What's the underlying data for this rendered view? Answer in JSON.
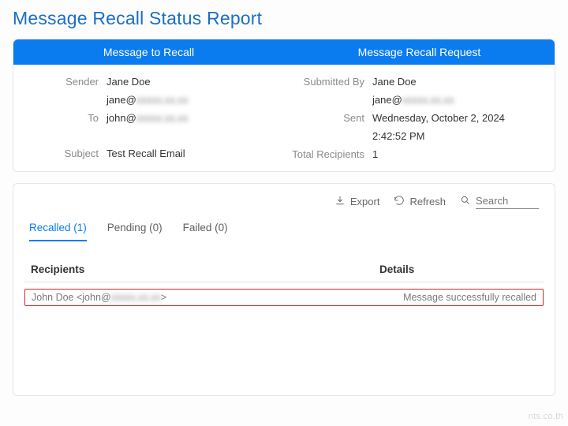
{
  "title": "Message Recall Status Report",
  "header": {
    "left": "Message to Recall",
    "right": "Message Recall Request"
  },
  "recall": {
    "sender_label": "Sender",
    "sender_name": "Jane Doe",
    "sender_email_prefix": "jane@",
    "sender_email_blur": "xxxxx.xx.xx",
    "to_label": "To",
    "to_prefix": "john@",
    "to_blur": "xxxxx.xx.xx",
    "subject_label": "Subject",
    "subject": "Test Recall Email"
  },
  "request": {
    "submitted_label": "Submitted By",
    "submitted_name": "Jane Doe",
    "submitted_email_prefix": "jane@",
    "submitted_email_blur": "xxxxx.xx.xx",
    "sent_label": "Sent",
    "sent_date": "Wednesday, October 2, 2024",
    "sent_time": "2:42:52 PM",
    "total_label": "Total Recipients",
    "total": "1"
  },
  "toolbar": {
    "export": "Export",
    "refresh": "Refresh",
    "search": "Search"
  },
  "tabs": {
    "recalled": "Recalled (1)",
    "pending": "Pending (0)",
    "failed": "Failed (0)"
  },
  "table": {
    "col_recipients": "Recipients",
    "col_details": "Details",
    "row": {
      "recipient_prefix": "John Doe <john@",
      "recipient_blur": "xxxxx.xx.xx",
      "recipient_suffix": ">",
      "details": "Message successfully recalled"
    }
  },
  "watermark": "nts.co.th"
}
